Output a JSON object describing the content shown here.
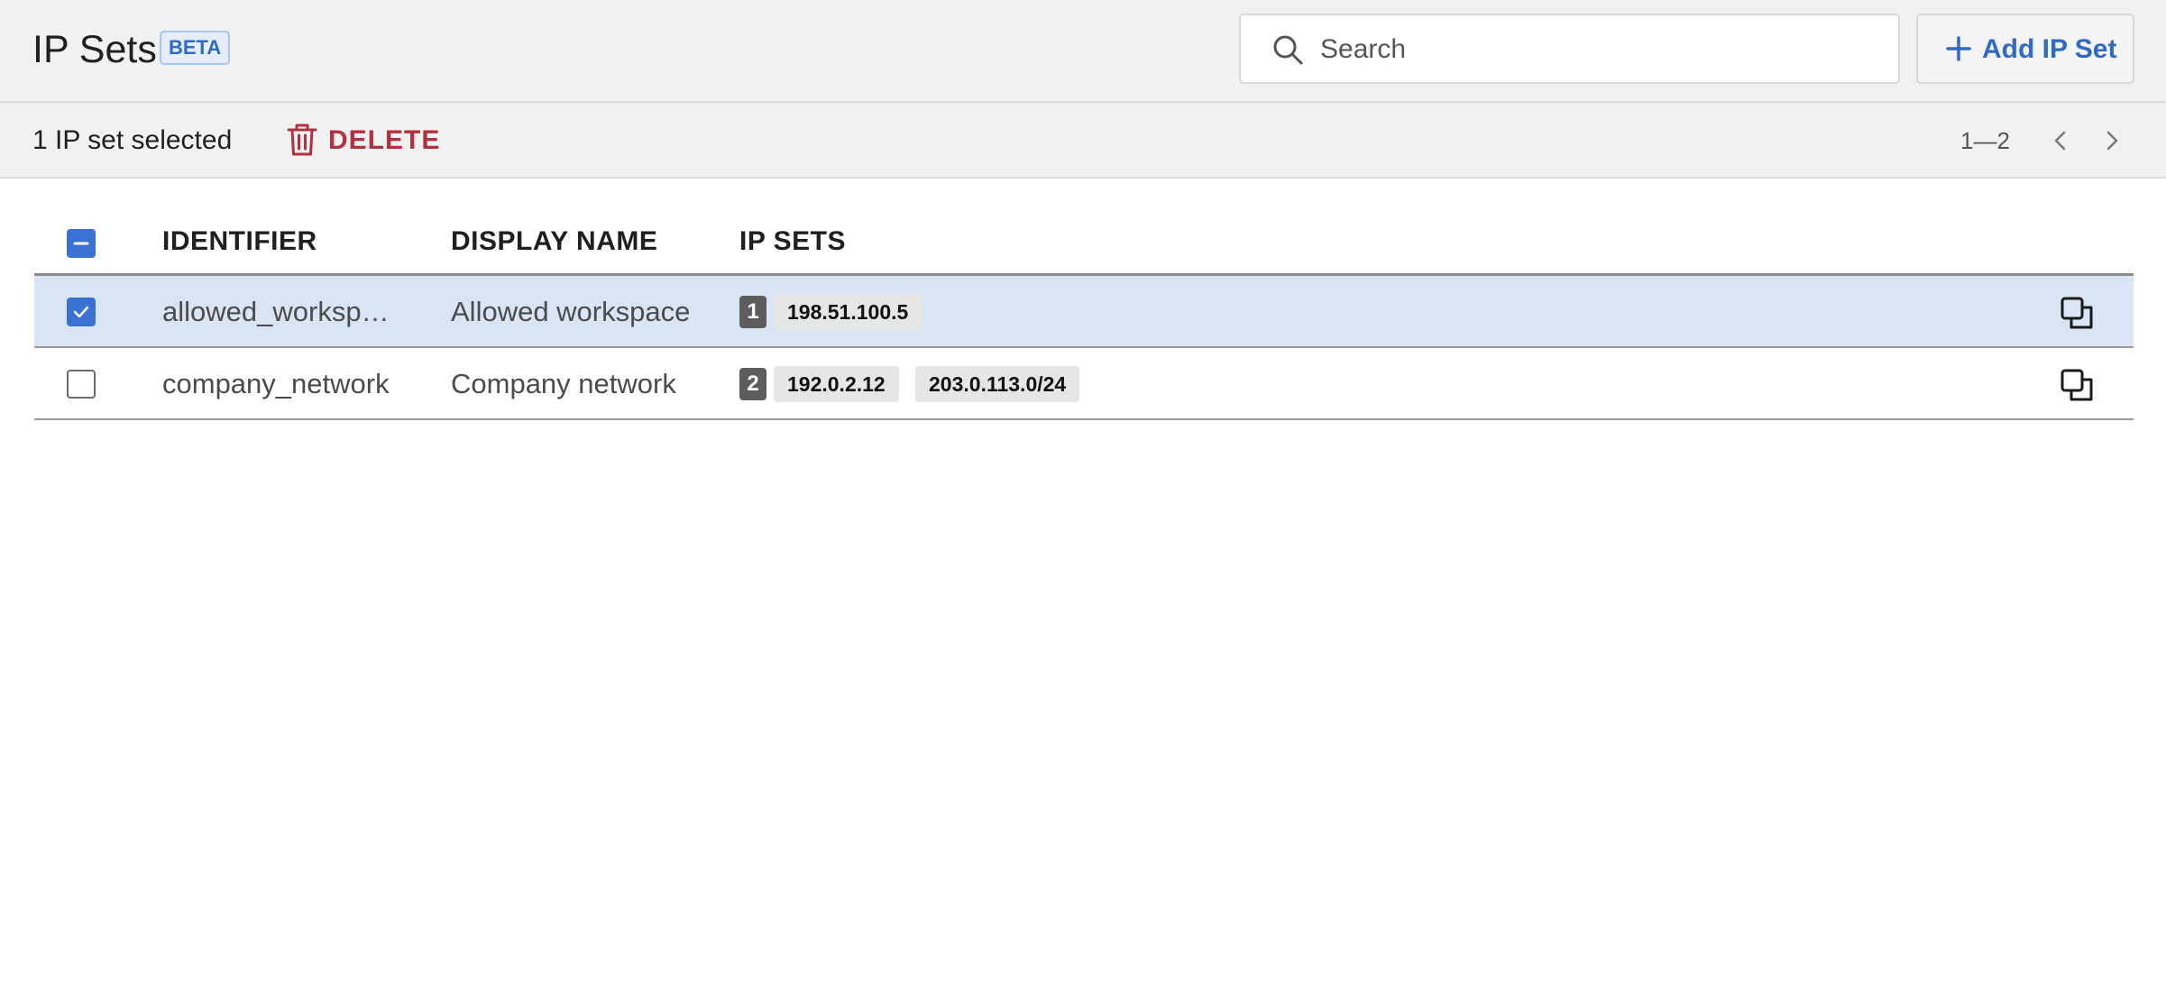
{
  "header": {
    "title": "IP Sets",
    "badge": "BETA",
    "search": {
      "placeholder": "Search",
      "value": ""
    },
    "add_button_label": "Add IP Set"
  },
  "toolbar": {
    "selected_text": "1 IP set selected",
    "delete_label": "DELETE",
    "pagination": "1—2"
  },
  "table": {
    "columns": [
      "IDENTIFIER",
      "DISPLAY NAME",
      "IP SETS"
    ],
    "rows": [
      {
        "identifier": "allowed_worksp…",
        "display_name": "Allowed workspace",
        "count": "1",
        "ips": [
          "198.51.100.5"
        ],
        "selected": true
      },
      {
        "identifier": "company_network",
        "display_name": "Company network",
        "count": "2",
        "ips": [
          "192.0.2.12",
          "203.0.113.0/24"
        ],
        "selected": false
      }
    ]
  },
  "colors": {
    "accent": "#3a72d2",
    "link_blue": "#2f6bc4",
    "danger": "#b0313f",
    "selected_row": "#d9e4f5"
  },
  "icons": [
    "search-icon",
    "plus-icon",
    "trash-icon",
    "chevron-left-icon",
    "chevron-right-icon",
    "copy-icon",
    "check-icon",
    "minus-icon"
  ]
}
